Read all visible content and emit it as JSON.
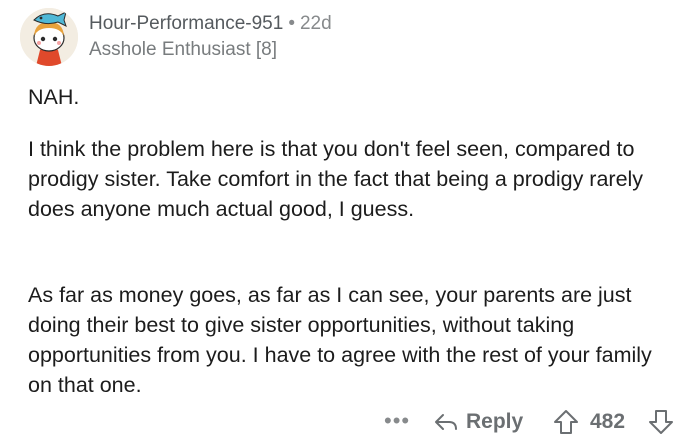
{
  "comment": {
    "author": "Hour-Performance-951",
    "separator": "•",
    "age": "22d",
    "flair": "Asshole Enthusiast [8]",
    "avatar_icon": "snoo-avatar-icon",
    "paragraphs": [
      "NAH.",
      "I think the problem here is that you don't feel seen, compared to prodigy sister.  Take comfort in the fact that being a prodigy rarely does anyone much actual good, I guess.",
      "As far as money goes, as far as I can see, your parents are just doing their best to give sister opportunities, without taking opportunities from you.  I have to agree with the rest of your family on that one."
    ]
  },
  "actions": {
    "more_label": "•••",
    "reply_label": "Reply",
    "score": "482",
    "upvote_icon": "upvote-arrow-icon",
    "downvote_icon": "downvote-arrow-icon",
    "reply_icon": "reply-arrow-icon"
  },
  "colors": {
    "text": "#1c1c1c",
    "meta": "#878a8c",
    "action": "#6b6f72"
  }
}
